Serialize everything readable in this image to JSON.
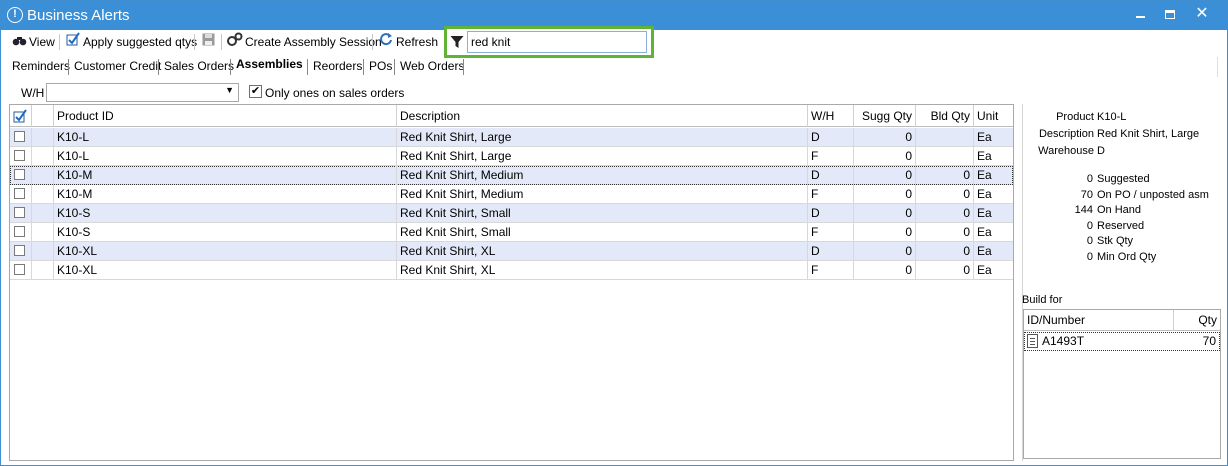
{
  "window": {
    "title": "Business Alerts"
  },
  "toolbar": {
    "view_label": "View",
    "apply_label": "Apply suggested qtys",
    "create_session_label": "Create Assembly Session",
    "refresh_label": "Refresh",
    "filter_value": "red knit"
  },
  "tabs": [
    {
      "label": "Reminders"
    },
    {
      "label": "Customer Credit"
    },
    {
      "label": "Sales Orders"
    },
    {
      "label": "Assemblies"
    },
    {
      "label": "Reorders"
    },
    {
      "label": "POs"
    },
    {
      "label": "Web Orders"
    }
  ],
  "filters": {
    "wh_label": "W/H",
    "wh_value": "",
    "only_sales_orders_label": "Only ones on sales orders",
    "only_sales_orders_checked": true
  },
  "grid": {
    "headers": {
      "product_id": "Product ID",
      "description": "Description",
      "wh": "W/H",
      "sugg_qty": "Sugg Qty",
      "bld_qty": "Bld Qty",
      "unit": "Unit"
    },
    "rows": [
      {
        "product_id": "K10-L",
        "description": "Red Knit Shirt, Large",
        "wh": "D",
        "sugg_qty": "0",
        "bld_qty": "",
        "unit": "Ea"
      },
      {
        "product_id": "K10-L",
        "description": "Red Knit Shirt, Large",
        "wh": "F",
        "sugg_qty": "0",
        "bld_qty": "",
        "unit": "Ea"
      },
      {
        "product_id": "K10-M",
        "description": "Red Knit Shirt, Medium",
        "wh": "D",
        "sugg_qty": "0",
        "bld_qty": "0",
        "unit": "Ea"
      },
      {
        "product_id": "K10-M",
        "description": "Red Knit Shirt, Medium",
        "wh": "F",
        "sugg_qty": "0",
        "bld_qty": "0",
        "unit": "Ea"
      },
      {
        "product_id": "K10-S",
        "description": "Red Knit Shirt, Small",
        "wh": "D",
        "sugg_qty": "0",
        "bld_qty": "0",
        "unit": "Ea"
      },
      {
        "product_id": "K10-S",
        "description": "Red Knit Shirt, Small",
        "wh": "F",
        "sugg_qty": "0",
        "bld_qty": "0",
        "unit": "Ea"
      },
      {
        "product_id": "K10-XL",
        "description": "Red Knit Shirt, XL",
        "wh": "D",
        "sugg_qty": "0",
        "bld_qty": "0",
        "unit": "Ea"
      },
      {
        "product_id": "K10-XL",
        "description": "Red Knit Shirt, XL",
        "wh": "F",
        "sugg_qty": "0",
        "bld_qty": "0",
        "unit": "Ea"
      }
    ]
  },
  "details": {
    "product_label": "Product",
    "product_value": "K10-L",
    "description_label": "Description",
    "description_value": "Red Knit Shirt, Large",
    "warehouse_label": "Warehouse",
    "warehouse_value": "D",
    "stats": [
      {
        "value": "0",
        "label": "Suggested"
      },
      {
        "value": "70",
        "label": "On PO / unposted asm"
      },
      {
        "value": "144",
        "label": "On Hand"
      },
      {
        "value": "0",
        "label": "Reserved"
      },
      {
        "value": "0",
        "label": "Stk Qty"
      },
      {
        "value": "0",
        "label": "Min Ord Qty"
      }
    ],
    "build_for_label": "Build for",
    "build_headers": {
      "id": "ID/Number",
      "qty": "Qty"
    },
    "build_rows": [
      {
        "id": "A1493T",
        "qty": "70"
      }
    ]
  },
  "colors": {
    "titlebar": "#3a8fd6",
    "filter_highlight": "#5fb336",
    "row_shade": "#e3e9f8"
  }
}
